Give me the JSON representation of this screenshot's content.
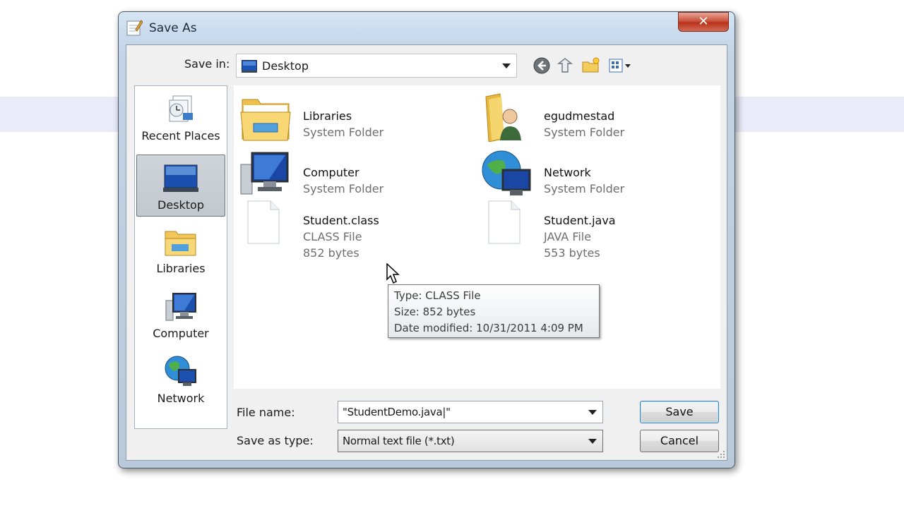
{
  "window": {
    "title": "Save As",
    "close_symbol": "✕"
  },
  "toolbar": {
    "save_in_label": "Save in:",
    "save_in_value": "Desktop",
    "icons": [
      "back-icon",
      "up-folder-icon",
      "new-folder-icon",
      "view-menu-icon"
    ]
  },
  "places": [
    {
      "label": "Recent Places",
      "icon": "recent-places-icon"
    },
    {
      "label": "Desktop",
      "icon": "desktop-icon",
      "selected": true
    },
    {
      "label": "Libraries",
      "icon": "libraries-icon"
    },
    {
      "label": "Computer",
      "icon": "computer-icon"
    },
    {
      "label": "Network",
      "icon": "network-icon"
    }
  ],
  "files": [
    {
      "name": "Libraries",
      "type": "System Folder",
      "icon": "libraries-folder-icon"
    },
    {
      "name": "egudmestad",
      "type": "System Folder",
      "icon": "user-folder-icon"
    },
    {
      "name": "Computer",
      "type": "System Folder",
      "icon": "computer-icon"
    },
    {
      "name": "Network",
      "type": "System Folder",
      "icon": "network-icon"
    },
    {
      "name": "Student.class",
      "type": "CLASS File",
      "size": "852 bytes",
      "icon": "file-icon"
    },
    {
      "name": "Student.java",
      "type": "JAVA File",
      "size": "553 bytes",
      "icon": "file-icon"
    }
  ],
  "tooltip": {
    "type_line": "Type: CLASS File",
    "size_line": "Size: 852 bytes",
    "date_line": "Date modified: 10/31/2011 4:09 PM"
  },
  "form": {
    "file_name_label": "File name:",
    "file_name_value": "\"StudentDemo.java|\"",
    "save_as_type_label": "Save as type:",
    "save_as_type_value": "Normal text file (*.txt)"
  },
  "buttons": {
    "save": "Save",
    "cancel": "Cancel"
  }
}
